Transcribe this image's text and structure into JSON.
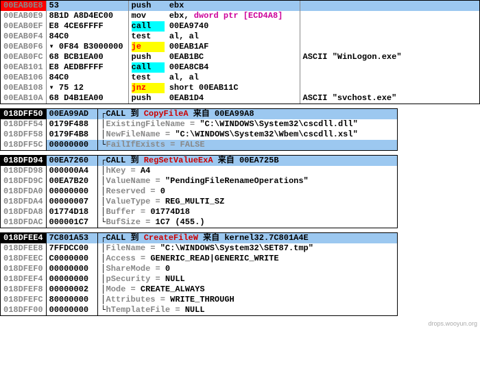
{
  "disasm": {
    "rows": [
      {
        "addr": "00EAB0E8",
        "bytes": "53",
        "mn": "push",
        "mncls": "",
        "ops": [
          {
            "t": "ebx",
            "cls": "op-reg"
          }
        ],
        "cmt": "",
        "sel": "addr",
        "hl": true
      },
      {
        "addr": "00EAB0E9",
        "bytes": "8B1D A8D4EC00",
        "mn": "mov",
        "mncls": "",
        "ops": [
          {
            "t": "ebx",
            "cls": "op-reg"
          },
          {
            "t": ", "
          },
          {
            "t": "dword ptr [ECD4A8]",
            "cls": "op-regptr"
          }
        ],
        "cmt": ""
      },
      {
        "addr": "00EAB0EF",
        "bytes": "E8 4CE6FFFF",
        "mn": "call",
        "mncls": "mn-call",
        "ops": [
          {
            "t": "00EA9740",
            "cls": "op-num"
          }
        ],
        "cmt": ""
      },
      {
        "addr": "00EAB0F4",
        "bytes": "84C0",
        "mn": "test",
        "mncls": "",
        "ops": [
          {
            "t": "al, al",
            "cls": "op-reg"
          }
        ],
        "cmt": ""
      },
      {
        "addr": "00EAB0F6",
        "bytes": "0F84 B3000000",
        "mn": "je",
        "mncls": "mn-je",
        "ops": [
          {
            "t": "00EAB1AF",
            "cls": "op-num"
          }
        ],
        "cmt": "",
        "mrk": "▾"
      },
      {
        "addr": "00EAB0FC",
        "bytes": "68 BCB1EA00",
        "mn": "push",
        "mncls": "",
        "ops": [
          {
            "t": "0EAB1BC",
            "cls": "op-num"
          }
        ],
        "cmt": "ASCII \"WinLogon.exe\""
      },
      {
        "addr": "00EAB101",
        "bytes": "E8 AEDBFFFF",
        "mn": "call",
        "mncls": "mn-call",
        "ops": [
          {
            "t": "00EA8CB4",
            "cls": "op-num"
          }
        ],
        "cmt": ""
      },
      {
        "addr": "00EAB106",
        "bytes": "84C0",
        "mn": "test",
        "mncls": "",
        "ops": [
          {
            "t": "al, al",
            "cls": "op-reg"
          }
        ],
        "cmt": ""
      },
      {
        "addr": "00EAB108",
        "bytes": "75 12",
        "mn": "jnz",
        "mncls": "mn-jnz",
        "ops": [
          {
            "t": "short 00EAB11C",
            "cls": "op-num"
          }
        ],
        "cmt": "",
        "mrk": "▾"
      },
      {
        "addr": "00EAB10A",
        "bytes": "68 D4B1EA00",
        "mn": "push",
        "mncls": "",
        "ops": [
          {
            "t": "0EAB1D4",
            "cls": "op-num"
          }
        ],
        "cmt": "ASCII \"svchost.exe\""
      }
    ]
  },
  "stack1": {
    "rows": [
      {
        "addr": "018DFF50",
        "val": "00EA99AD",
        "desc": [
          {
            "t": "CALL 到 "
          },
          {
            "t": "CopyFileA",
            "cls": "fn-red"
          },
          {
            "t": " 来自 00EA99A8"
          }
        ],
        "sel": true,
        "br": "┌"
      },
      {
        "addr": "018DFF54",
        "val": "0179F488",
        "desc": [
          {
            "t": "ExistingFileName = ",
            "cls": "grey"
          },
          {
            "t": "\"C:\\WINDOWS\\System32\\cscdll.dll\""
          }
        ],
        "br": "│"
      },
      {
        "addr": "018DFF58",
        "val": "0179F4B8",
        "desc": [
          {
            "t": "NewFileName = ",
            "cls": "grey"
          },
          {
            "t": "\"C:\\WINDOWS\\System32\\Wbem\\cscdll.xsl\""
          }
        ],
        "br": "│"
      },
      {
        "addr": "018DFF5C",
        "val": "00000000",
        "desc": [
          {
            "t": "FailIfExists = FALSE",
            "cls": "grey"
          }
        ],
        "br": "└",
        "hl": true
      }
    ]
  },
  "stack2": {
    "rows": [
      {
        "addr": "018DFD94",
        "val": "00EA7260",
        "desc": [
          {
            "t": "CALL 到 "
          },
          {
            "t": "RegSetValueExA",
            "cls": "fn-red"
          },
          {
            "t": " 来自  00EA725B"
          }
        ],
        "sel": true,
        "br": "┌"
      },
      {
        "addr": "018DFD98",
        "val": "000000A4",
        "desc": [
          {
            "t": "hKey = ",
            "cls": "grey"
          },
          {
            "t": "A4"
          }
        ],
        "br": "│"
      },
      {
        "addr": "018DFD9C",
        "val": "00EA7B20",
        "desc": [
          {
            "t": "ValueName = ",
            "cls": "grey"
          },
          {
            "t": "\"PendingFileRenameOperations\""
          }
        ],
        "br": "│"
      },
      {
        "addr": "018DFDA0",
        "val": "00000000",
        "desc": [
          {
            "t": "Reserved = ",
            "cls": "grey"
          },
          {
            "t": "0"
          }
        ],
        "br": "│"
      },
      {
        "addr": "018DFDA4",
        "val": "00000007",
        "desc": [
          {
            "t": "ValueType = ",
            "cls": "grey"
          },
          {
            "t": "REG_MULTI_SZ"
          }
        ],
        "br": "│"
      },
      {
        "addr": "018DFDA8",
        "val": "01774D18",
        "desc": [
          {
            "t": "Buffer = ",
            "cls": "grey"
          },
          {
            "t": "01774D18"
          }
        ],
        "br": "│"
      },
      {
        "addr": "018DFDAC",
        "val": "000001C7",
        "desc": [
          {
            "t": "BufSize = ",
            "cls": "grey"
          },
          {
            "t": "1C7 (455.)"
          }
        ],
        "br": "└"
      }
    ]
  },
  "stack3": {
    "rows": [
      {
        "addr": "018DFEE4",
        "val": "7C801A53",
        "desc": [
          {
            "t": "CALL 到 "
          },
          {
            "t": "CreateFileW",
            "cls": "fn-red"
          },
          {
            "t": " 来自 kernel32.7C801A4E"
          }
        ],
        "sel": true,
        "br": "┌"
      },
      {
        "addr": "018DFEE8",
        "val": "7FFDCC00",
        "desc": [
          {
            "t": "FileName = ",
            "cls": "grey"
          },
          {
            "t": "\"C:\\WINDOWS\\System32\\SET87.tmp\""
          }
        ],
        "br": "│"
      },
      {
        "addr": "018DFEEC",
        "val": "C0000000",
        "desc": [
          {
            "t": "Access = ",
            "cls": "grey"
          },
          {
            "t": "GENERIC_READ|GENERIC_WRITE"
          }
        ],
        "br": "│"
      },
      {
        "addr": "018DFEF0",
        "val": "00000000",
        "desc": [
          {
            "t": "ShareMode = ",
            "cls": "grey"
          },
          {
            "t": "0"
          }
        ],
        "br": "│"
      },
      {
        "addr": "018DFEF4",
        "val": "00000000",
        "desc": [
          {
            "t": "pSecurity = ",
            "cls": "grey"
          },
          {
            "t": "NULL"
          }
        ],
        "br": "│"
      },
      {
        "addr": "018DFEF8",
        "val": "00000002",
        "desc": [
          {
            "t": "Mode = ",
            "cls": "grey"
          },
          {
            "t": "CREATE_ALWAYS"
          }
        ],
        "br": "│"
      },
      {
        "addr": "018DFEFC",
        "val": "80000000",
        "desc": [
          {
            "t": "Attributes = ",
            "cls": "grey"
          },
          {
            "t": "WRITE_THROUGH"
          }
        ],
        "br": "│"
      },
      {
        "addr": "018DFF00",
        "val": "00000000",
        "desc": [
          {
            "t": "hTemplateFile = ",
            "cls": "grey"
          },
          {
            "t": "NULL"
          }
        ],
        "br": "└"
      }
    ]
  },
  "watermark": "drops.wooyun.org"
}
